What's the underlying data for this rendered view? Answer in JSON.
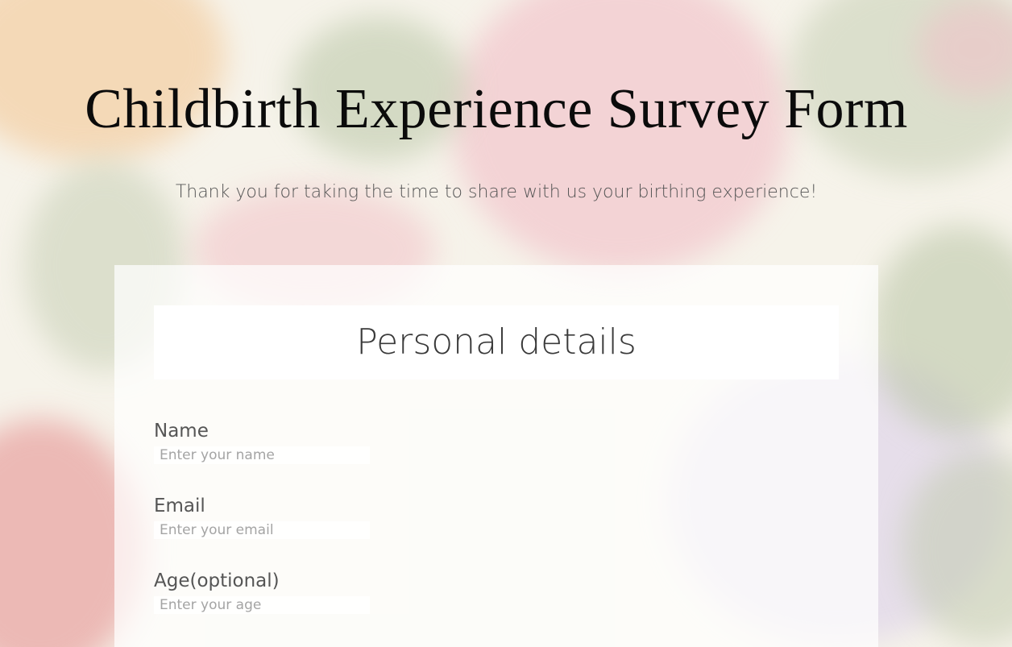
{
  "title": "Childbirth Experience Survey Form",
  "description": "Thank you for taking the time to share with us your birthing experience!",
  "form": {
    "section_title": "Personal details",
    "fields": {
      "name": {
        "label": "Name",
        "placeholder": "Enter your name"
      },
      "email": {
        "label": "Email",
        "placeholder": "Enter your email"
      },
      "age": {
        "label": "Age(optional)",
        "placeholder": "Enter your age"
      }
    }
  },
  "colors": {
    "title_text": "#0b0b0b",
    "body_text": "#555555",
    "card_background": "rgba(255,255,255,0.72)",
    "section_header_background": "#ffffff"
  }
}
